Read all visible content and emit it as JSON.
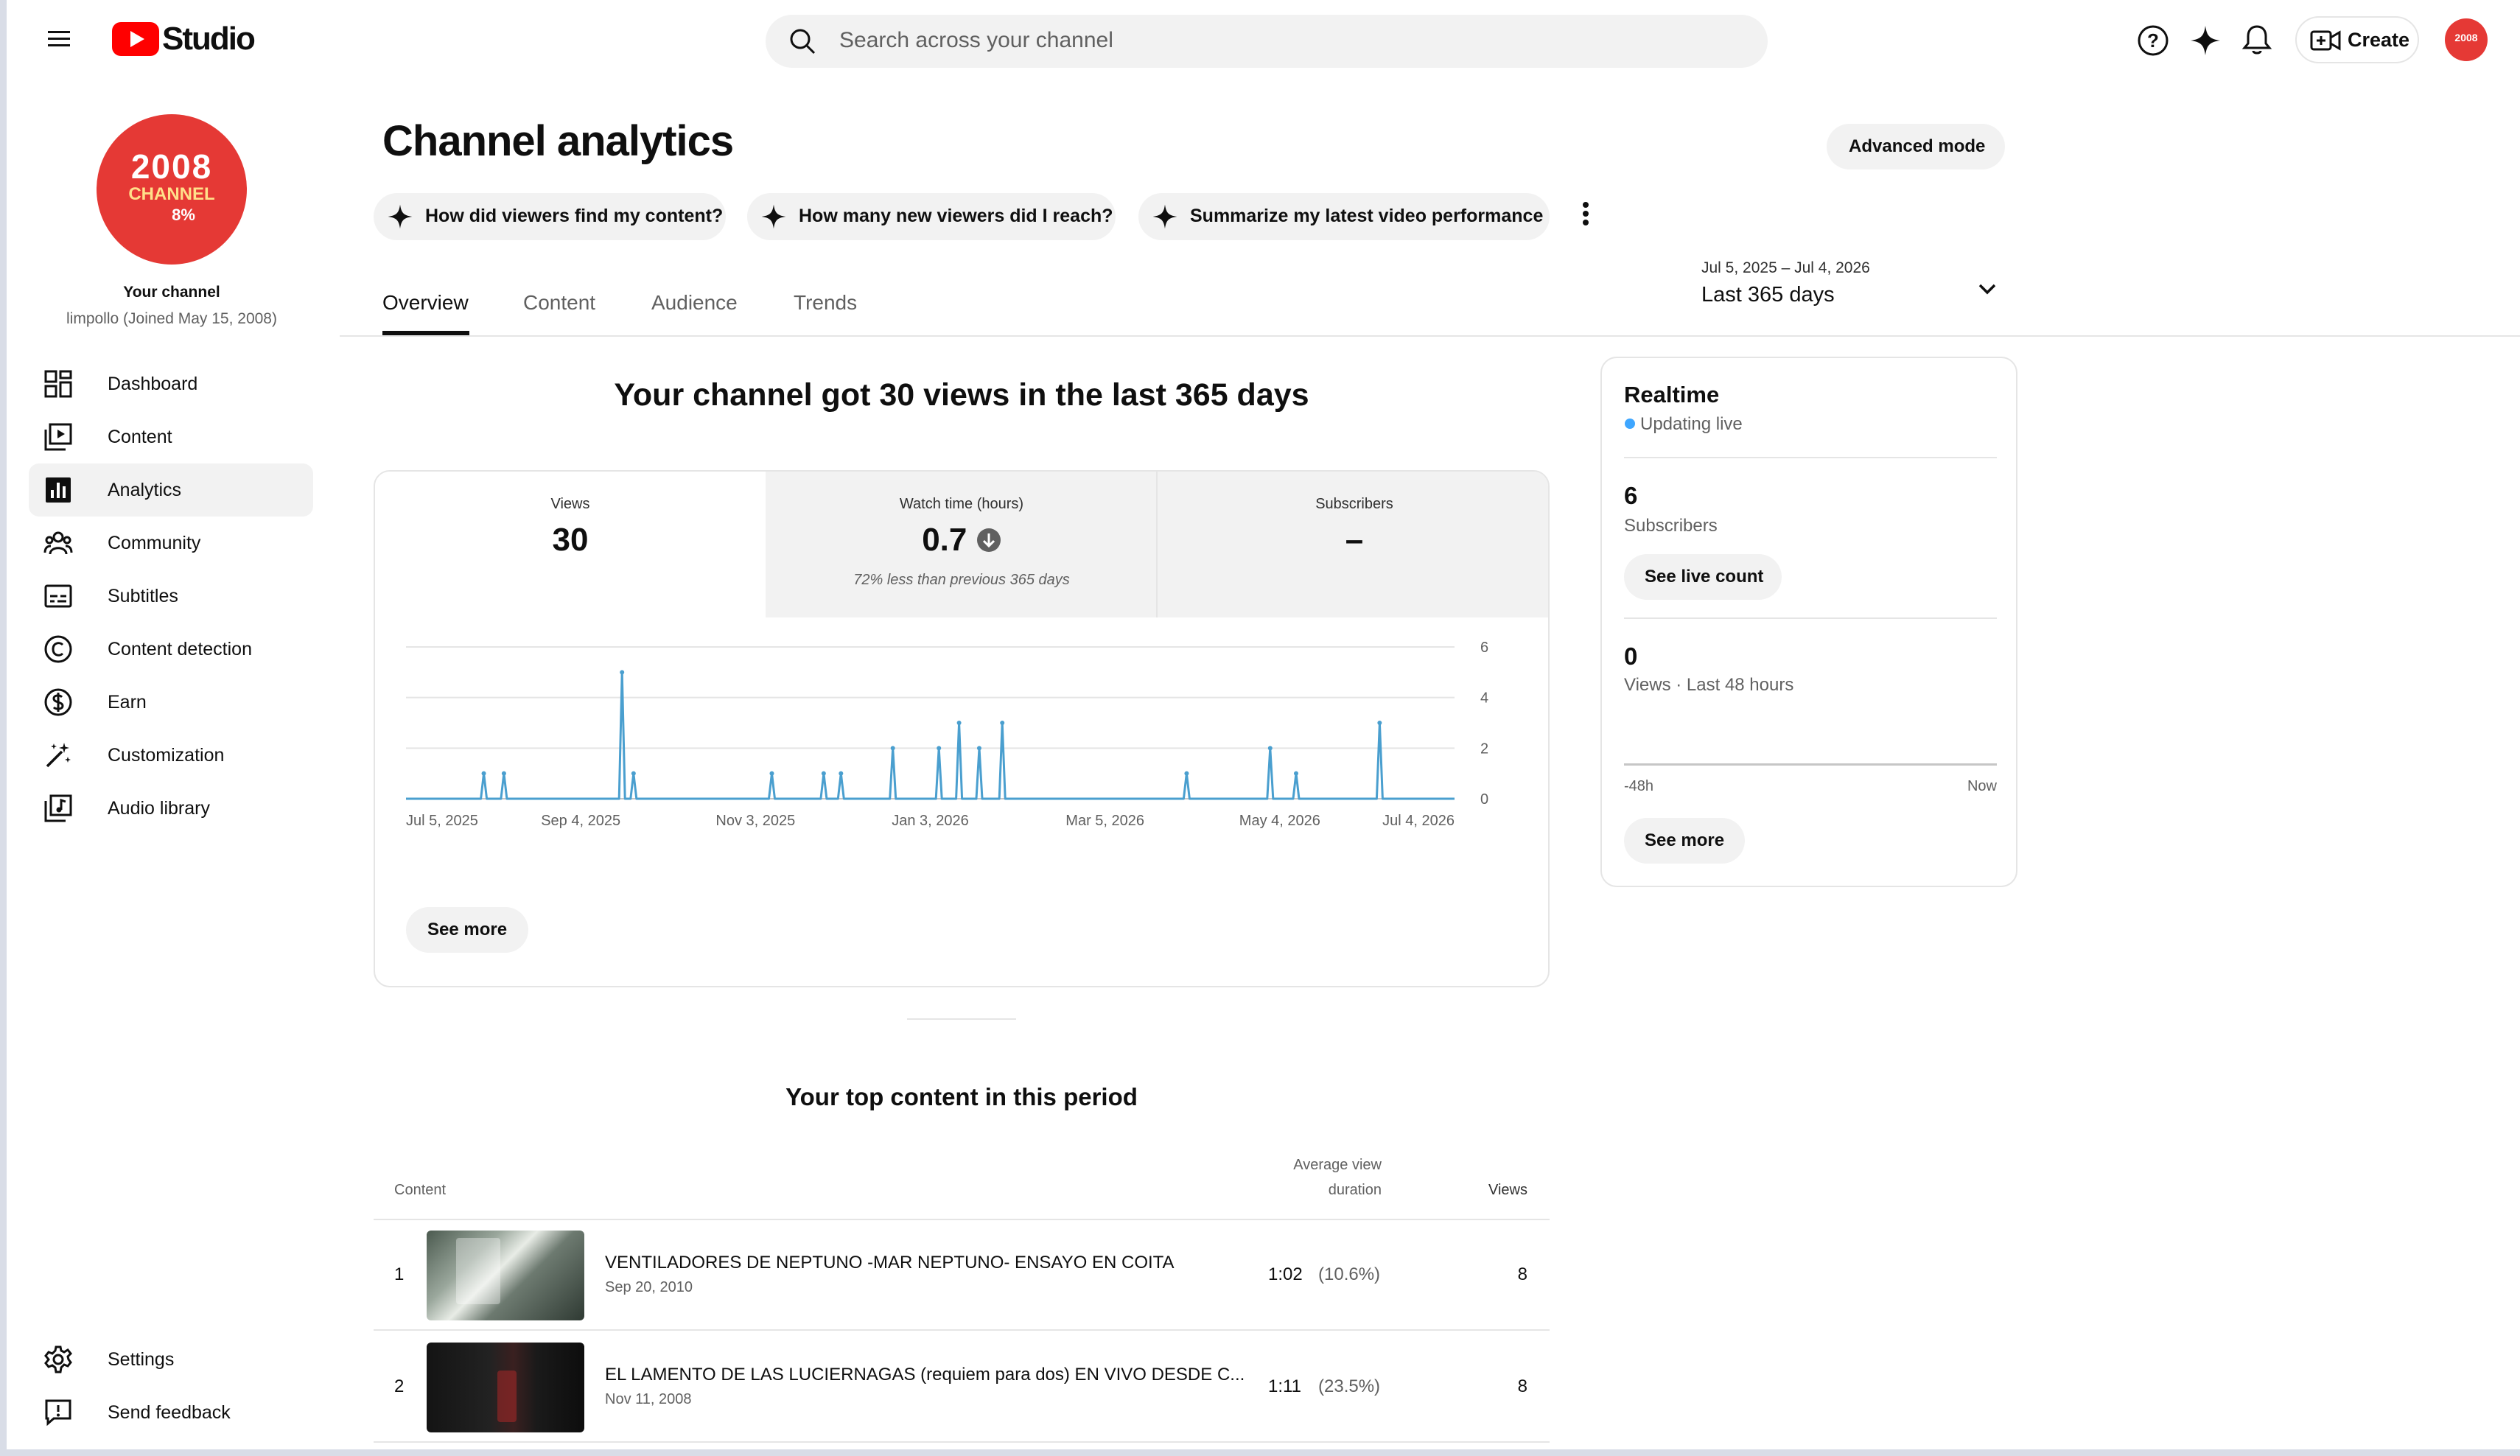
{
  "header": {
    "logo_text": "Studio",
    "search_placeholder": "Search across your channel",
    "create_label": "Create",
    "avatar_text": "2008"
  },
  "sidebar": {
    "channel_avatar": {
      "line1": "2008",
      "line2": "CHANNEL",
      "line3": "8%"
    },
    "your_channel": "Your channel",
    "channel_sub": "limpollo (Joined May 15, 2008)",
    "items": [
      {
        "label": "Dashboard",
        "icon": "dashboard-icon"
      },
      {
        "label": "Content",
        "icon": "content-icon"
      },
      {
        "label": "Analytics",
        "icon": "analytics-icon",
        "active": true
      },
      {
        "label": "Community",
        "icon": "community-icon"
      },
      {
        "label": "Subtitles",
        "icon": "subtitles-icon"
      },
      {
        "label": "Content detection",
        "icon": "copyright-icon"
      },
      {
        "label": "Earn",
        "icon": "dollar-icon"
      },
      {
        "label": "Customization",
        "icon": "magic-wand-icon"
      },
      {
        "label": "Audio library",
        "icon": "audio-library-icon"
      }
    ],
    "bottom": [
      {
        "label": "Settings",
        "icon": "gear-icon"
      },
      {
        "label": "Send feedback",
        "icon": "feedback-icon"
      }
    ]
  },
  "main": {
    "title": "Channel analytics",
    "advanced_mode": "Advanced mode",
    "chips": [
      "How did viewers find my content?",
      "How many new viewers did I reach?",
      "Summarize my latest video performance"
    ],
    "tabs": [
      "Overview",
      "Content",
      "Audience",
      "Trends"
    ],
    "active_tab": "Overview",
    "date_range": {
      "dates": "Jul 5, 2025 – Jul 4, 2026",
      "label": "Last 365 days"
    },
    "headline": "Your channel got 30 views in the last 365 days",
    "metrics": [
      {
        "label": "Views",
        "value": "30"
      },
      {
        "label": "Watch time (hours)",
        "value": "0.7",
        "note": "72% less than previous 365 days",
        "trend": "down"
      },
      {
        "label": "Subscribers",
        "value": "–"
      }
    ],
    "see_more": "See more",
    "top_content": {
      "title": "Your top content in this period",
      "col_content": "Content",
      "col_avd_line1": "Average view",
      "col_avd_line2": "duration",
      "col_views": "Views",
      "rows": [
        {
          "rank": "1",
          "title": "VENTILADORES DE NEPTUNO -MAR NEPTUNO- ENSAYO EN COITA",
          "date": "Sep 20, 2010",
          "duration": "1:02",
          "pct": "(10.6%)",
          "views": "8"
        },
        {
          "rank": "2",
          "title": "EL LAMENTO DE LAS LUCIERNAGAS (requiem para dos) EN VIVO DESDE C...",
          "date": "Nov 11, 2008",
          "duration": "1:11",
          "pct": "(23.5%)",
          "views": "8"
        }
      ]
    }
  },
  "realtime": {
    "title": "Realtime",
    "status": "Updating live",
    "subscribers_value": "6",
    "subscribers_label": "Subscribers",
    "see_live_count": "See live count",
    "views_value": "0",
    "views_label": "Views · Last 48 hours",
    "axis_left": "-48h",
    "axis_right": "Now",
    "see_more": "See more"
  },
  "colors": {
    "accent": "#3ea6ff",
    "line": "#4a9fcf",
    "brand_red": "#ff0000",
    "avatar_red": "#e53935"
  },
  "chart_data": {
    "type": "line",
    "x_start": "2025-07-05",
    "x_end": "2026-07-04",
    "x_ticks": [
      "Jul 5, 2025",
      "Sep 4, 2025",
      "Nov 3, 2025",
      "Jan 3, 2026",
      "Mar 5, 2026",
      "May 4, 2026",
      "Jul 4, 2026"
    ],
    "y_ticks": [
      "0",
      "2",
      "4",
      "6"
    ],
    "ylim": [
      0,
      6
    ],
    "grid": true,
    "series": [
      {
        "points": [
          {
            "date": "2025-08-01",
            "value": 1
          },
          {
            "date": "2025-08-08",
            "value": 1
          },
          {
            "date": "2025-09-18",
            "value": 5
          },
          {
            "date": "2025-09-22",
            "value": 1
          },
          {
            "date": "2025-11-09",
            "value": 1
          },
          {
            "date": "2025-11-27",
            "value": 1
          },
          {
            "date": "2025-12-03",
            "value": 1
          },
          {
            "date": "2025-12-21",
            "value": 2
          },
          {
            "date": "2026-01-06",
            "value": 2
          },
          {
            "date": "2026-01-13",
            "value": 3
          },
          {
            "date": "2026-01-20",
            "value": 2
          },
          {
            "date": "2026-01-28",
            "value": 3
          },
          {
            "date": "2026-04-02",
            "value": 1
          },
          {
            "date": "2026-05-01",
            "value": 2
          },
          {
            "date": "2026-05-10",
            "value": 1
          },
          {
            "date": "2026-06-08",
            "value": 3
          }
        ]
      }
    ]
  }
}
